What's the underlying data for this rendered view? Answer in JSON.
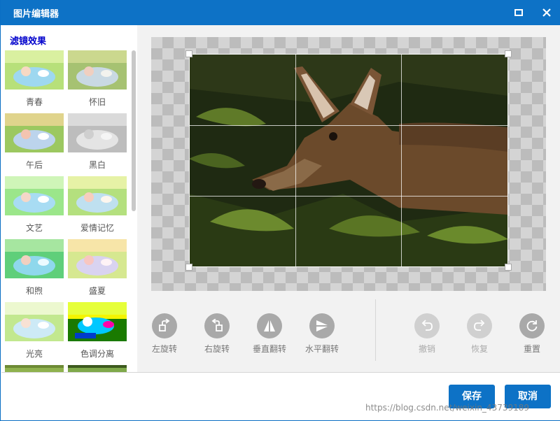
{
  "window": {
    "title": "图片编辑器",
    "title_bar_color": "#0d72c6",
    "maximize_icon": "maximize-icon",
    "close_icon": "close-icon"
  },
  "sidebar": {
    "title": "滤镜效果",
    "filters": [
      {
        "label": "青春"
      },
      {
        "label": "怀旧"
      },
      {
        "label": "午后"
      },
      {
        "label": "黑白"
      },
      {
        "label": "文艺"
      },
      {
        "label": "爱情记忆"
      },
      {
        "label": "和煦"
      },
      {
        "label": "盛夏"
      },
      {
        "label": "光亮"
      },
      {
        "label": "色调分离"
      }
    ]
  },
  "toolbar": {
    "rotate_left": "左旋转",
    "rotate_right": "右旋转",
    "flip_vertical": "垂直翻转",
    "flip_horizontal": "水平翻转",
    "undo": "撤销",
    "redo": "恢复",
    "reset": "重置"
  },
  "footer": {
    "save_label": "保存",
    "cancel_label": "取消",
    "watermark": "https://blog.csdn.net/weixin_43739189"
  },
  "colors": {
    "accent": "#0d72c6",
    "tool_icon_bg": "#a9a9a9",
    "tool_icon_disabled_bg": "#d0d0d0"
  }
}
